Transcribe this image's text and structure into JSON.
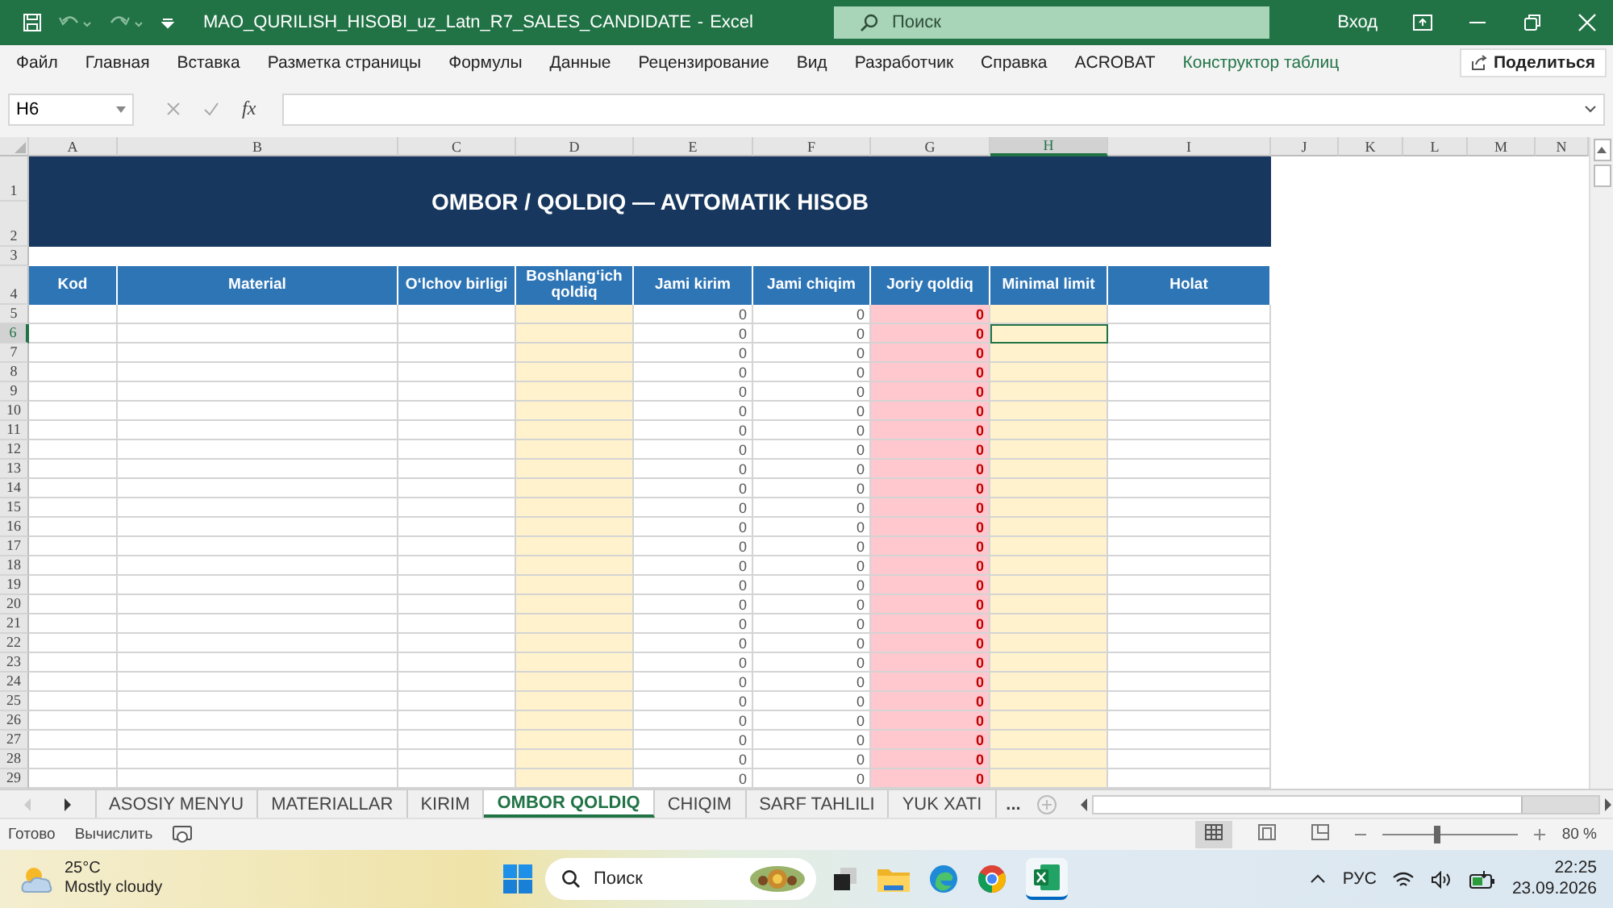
{
  "title_bar": {
    "file_name": "MAO_QURILISH_HISOBI_uz_Latn_R7_SALES_CANDIDATE",
    "separator": "-",
    "app": "Excel",
    "search_placeholder": "Поиск",
    "sign_in": "Вход"
  },
  "ribbon": {
    "tabs": [
      {
        "label": "Файл",
        "kind": "normal"
      },
      {
        "label": "Главная",
        "kind": "normal"
      },
      {
        "label": "Вставка",
        "kind": "normal"
      },
      {
        "label": "Разметка страницы",
        "kind": "normal"
      },
      {
        "label": "Формулы",
        "kind": "normal"
      },
      {
        "label": "Данные",
        "kind": "normal"
      },
      {
        "label": "Рецензирование",
        "kind": "normal"
      },
      {
        "label": "Вид",
        "kind": "normal"
      },
      {
        "label": "Разработчик",
        "kind": "normal"
      },
      {
        "label": "Справка",
        "kind": "normal"
      },
      {
        "label": "ACROBAT",
        "kind": "normal"
      },
      {
        "label": "Конструктор таблиц",
        "kind": "contextual"
      }
    ],
    "share": "Поделиться"
  },
  "formula_bar": {
    "name_box": "H6",
    "function_label": "fx"
  },
  "sheet": {
    "columns": [
      {
        "label": "A",
        "selected": false
      },
      {
        "label": "B",
        "selected": false
      },
      {
        "label": "C",
        "selected": false
      },
      {
        "label": "D",
        "selected": false
      },
      {
        "label": "E",
        "selected": false
      },
      {
        "label": "F",
        "selected": false
      },
      {
        "label": "G",
        "selected": false
      },
      {
        "label": "H",
        "selected": true
      },
      {
        "label": "I",
        "selected": false
      },
      {
        "label": "J",
        "selected": false
      },
      {
        "label": "K",
        "selected": false
      },
      {
        "label": "L",
        "selected": false
      },
      {
        "label": "M",
        "selected": false
      },
      {
        "label": "N",
        "selected": false
      }
    ],
    "title_rows": [
      "1",
      "2"
    ],
    "title": "OMBOR / QOLDIQ — AVTOMATIK HISOB",
    "blank_row": "3",
    "header_row": "4",
    "headers": [
      "Kod",
      "Material",
      "O‘lchov birligi",
      "Boshlang‘ich qoldiq",
      "Jami kirim",
      "Jami chiqim",
      "Joriy qoldiq",
      "Minimal limit",
      "Holat"
    ],
    "rows": [
      {
        "number": "5",
        "jami_kirim": "0",
        "jami_chiqim": "0",
        "joriy_qoldiq": "0",
        "selected": false
      },
      {
        "number": "6",
        "jami_kirim": "0",
        "jami_chiqim": "0",
        "joriy_qoldiq": "0",
        "selected": true
      },
      {
        "number": "7",
        "jami_kirim": "0",
        "jami_chiqim": "0",
        "joriy_qoldiq": "0",
        "selected": false
      },
      {
        "number": "8",
        "jami_kirim": "0",
        "jami_chiqim": "0",
        "joriy_qoldiq": "0",
        "selected": false
      },
      {
        "number": "9",
        "jami_kirim": "0",
        "jami_chiqim": "0",
        "joriy_qoldiq": "0",
        "selected": false
      },
      {
        "number": "10",
        "jami_kirim": "0",
        "jami_chiqim": "0",
        "joriy_qoldiq": "0",
        "selected": false
      },
      {
        "number": "11",
        "jami_kirim": "0",
        "jami_chiqim": "0",
        "joriy_qoldiq": "0",
        "selected": false
      },
      {
        "number": "12",
        "jami_kirim": "0",
        "jami_chiqim": "0",
        "joriy_qoldiq": "0",
        "selected": false
      },
      {
        "number": "13",
        "jami_kirim": "0",
        "jami_chiqim": "0",
        "joriy_qoldiq": "0",
        "selected": false
      },
      {
        "number": "14",
        "jami_kirim": "0",
        "jami_chiqim": "0",
        "joriy_qoldiq": "0",
        "selected": false
      },
      {
        "number": "15",
        "jami_kirim": "0",
        "jami_chiqim": "0",
        "joriy_qoldiq": "0",
        "selected": false
      },
      {
        "number": "16",
        "jami_kirim": "0",
        "jami_chiqim": "0",
        "joriy_qoldiq": "0",
        "selected": false
      },
      {
        "number": "17",
        "jami_kirim": "0",
        "jami_chiqim": "0",
        "joriy_qoldiq": "0",
        "selected": false
      },
      {
        "number": "18",
        "jami_kirim": "0",
        "jami_chiqim": "0",
        "joriy_qoldiq": "0",
        "selected": false
      },
      {
        "number": "19",
        "jami_kirim": "0",
        "jami_chiqim": "0",
        "joriy_qoldiq": "0",
        "selected": false
      },
      {
        "number": "20",
        "jami_kirim": "0",
        "jami_chiqim": "0",
        "joriy_qoldiq": "0",
        "selected": false
      },
      {
        "number": "21",
        "jami_kirim": "0",
        "jami_chiqim": "0",
        "joriy_qoldiq": "0",
        "selected": false
      },
      {
        "number": "22",
        "jami_kirim": "0",
        "jami_chiqim": "0",
        "joriy_qoldiq": "0",
        "selected": false
      },
      {
        "number": "23",
        "jami_kirim": "0",
        "jami_chiqim": "0",
        "joriy_qoldiq": "0",
        "selected": false
      },
      {
        "number": "24",
        "jami_kirim": "0",
        "jami_chiqim": "0",
        "joriy_qoldiq": "0",
        "selected": false
      },
      {
        "number": "25",
        "jami_kirim": "0",
        "jami_chiqim": "0",
        "joriy_qoldiq": "0",
        "selected": false
      },
      {
        "number": "26",
        "jami_kirim": "0",
        "jami_chiqim": "0",
        "joriy_qoldiq": "0",
        "selected": false
      },
      {
        "number": "27",
        "jami_kirim": "0",
        "jami_chiqim": "0",
        "joriy_qoldiq": "0",
        "selected": false
      },
      {
        "number": "28",
        "jami_kirim": "0",
        "jami_chiqim": "0",
        "joriy_qoldiq": "0",
        "selected": false
      },
      {
        "number": "29",
        "jami_kirim": "0",
        "jami_chiqim": "0",
        "joriy_qoldiq": "0",
        "selected": false
      }
    ]
  },
  "sheet_tabs": {
    "tabs": [
      {
        "label": "ASOSIY MENYU",
        "selected": false
      },
      {
        "label": "MATERIALLAR",
        "selected": false
      },
      {
        "label": "KIRIM",
        "selected": false
      },
      {
        "label": "OMBOR QOLDIQ",
        "selected": true
      },
      {
        "label": "CHIQIM",
        "selected": false
      },
      {
        "label": "SARF TAHLILI",
        "selected": false
      },
      {
        "label": "YUK XATI",
        "selected": false
      }
    ],
    "more": "..."
  },
  "status_bar": {
    "ready": "Готово",
    "calculate": "Вычислить",
    "zoom": {
      "level": 0.4,
      "reading": "80 %"
    }
  },
  "taskbar": {
    "weather": {
      "temperature": "25°C",
      "condition": "Mostly cloudy"
    },
    "search_placeholder": "Поиск",
    "language": "РУС",
    "time": "22:25",
    "date": "23.09.2026"
  }
}
